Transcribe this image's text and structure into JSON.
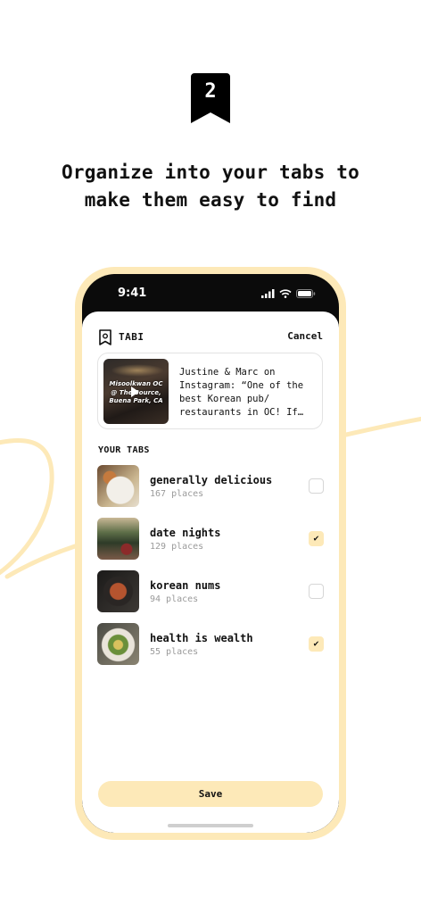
{
  "step": {
    "number": "2"
  },
  "headline": {
    "line1": "Organize into your tabs to",
    "line2": "make them easy to find"
  },
  "status_bar": {
    "time": "9:41"
  },
  "header": {
    "app_name": "TABI",
    "cancel_label": "Cancel"
  },
  "post": {
    "thumbnail_text": "Misoolkwan OC @ The Source, Buena Park, CA",
    "description": "Justine & Marc on Instagram: “One of the best Korean pub/ restaurants in OC! If…"
  },
  "tabs_section": {
    "label": "YOUR TABS",
    "items": [
      {
        "name": "generally delicious",
        "count": "167 places",
        "checked": false
      },
      {
        "name": "date nights",
        "count": "129 places",
        "checked": true
      },
      {
        "name": "korean nums",
        "count": "94 places",
        "checked": false
      },
      {
        "name": "health is wealth",
        "count": "55 places",
        "checked": true
      }
    ]
  },
  "save_label": "Save",
  "colors": {
    "accent": "#fde9b8",
    "text": "#111111",
    "muted": "#9a9a9a"
  },
  "check_glyph": "✔"
}
